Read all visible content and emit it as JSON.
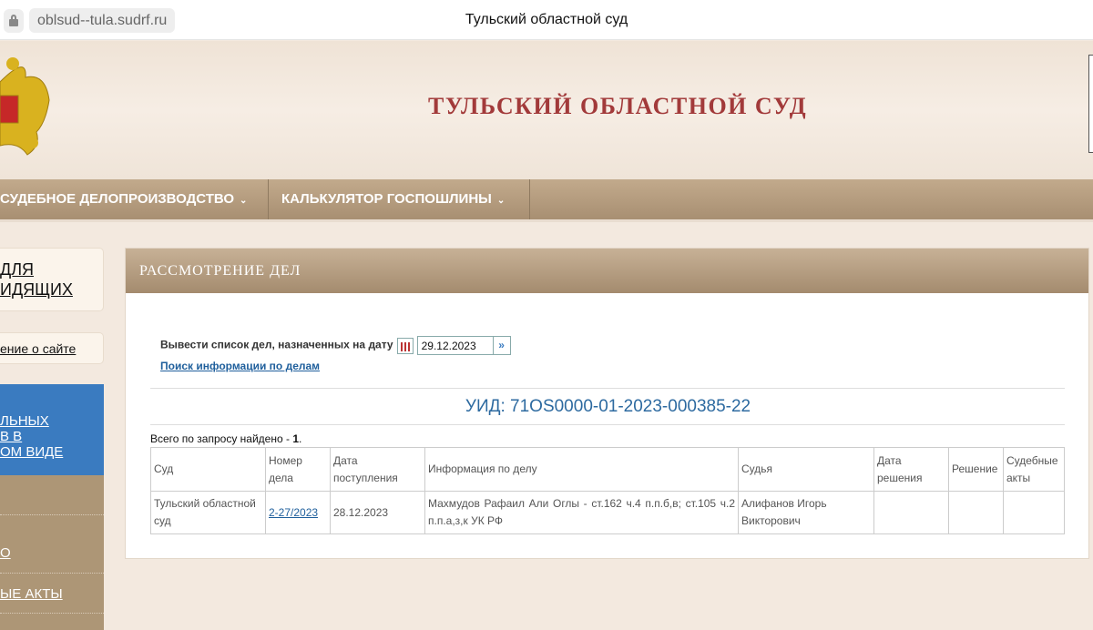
{
  "browser": {
    "url": "oblsud--tula.sudrf.ru",
    "tab_title": "Тульский областной суд"
  },
  "header": {
    "title": "ТУЛЬСКИЙ ОБЛАСТНОЙ СУД"
  },
  "nav": [
    {
      "label": "СУДЕБНОЕ ДЕЛОПРОИЗВОДСТВО"
    },
    {
      "label": "КАЛЬКУЛЯТОР ГОСПОШЛИНЫ"
    }
  ],
  "sidebar": {
    "visually_impaired": [
      "ДЛЯ",
      "ИДЯЩИХ"
    ],
    "about": "ение о сайте",
    "blue_link": [
      "ЛЬНЫХ",
      "В В",
      "ОМ ВИДЕ"
    ],
    "items": [
      "О",
      "ЫЕ АКТЫ"
    ]
  },
  "panel": {
    "title": "РАССМОТРЕНИЕ ДЕЛ",
    "date_label": "Вывести список дел, назначенных на дату",
    "date_value": "29.12.2023",
    "search_link": "Поиск информации по делам",
    "uid": "УИД: 71OS0000-01-2023-000385-22",
    "found_prefix": "Всего по запросу найдено - ",
    "found_count": "1",
    "found_suffix": "."
  },
  "table": {
    "headers": [
      "Суд",
      "Номер дела",
      "Дата поступления",
      "Информация по делу",
      "Судья",
      "Дата решения",
      "Решение",
      "Судебные акты"
    ],
    "rows": [
      {
        "court": "Тульский областной суд",
        "case_no": "2-27/2023",
        "received": "28.12.2023",
        "info": "Махмудов Рафаил Али Оглы - ст.162 ч.4 п.п.б,в; ст.105 ч.2 п.п.а,з,к УК РФ",
        "judge": "Алифанов Игорь Викторович",
        "decision_date": "",
        "decision": "",
        "acts": ""
      }
    ]
  },
  "colors": {
    "title_red": "#a23a3a",
    "nav_brown": "#ad9676",
    "blue": "#3a7bc0",
    "link": "#1f5f9c"
  }
}
